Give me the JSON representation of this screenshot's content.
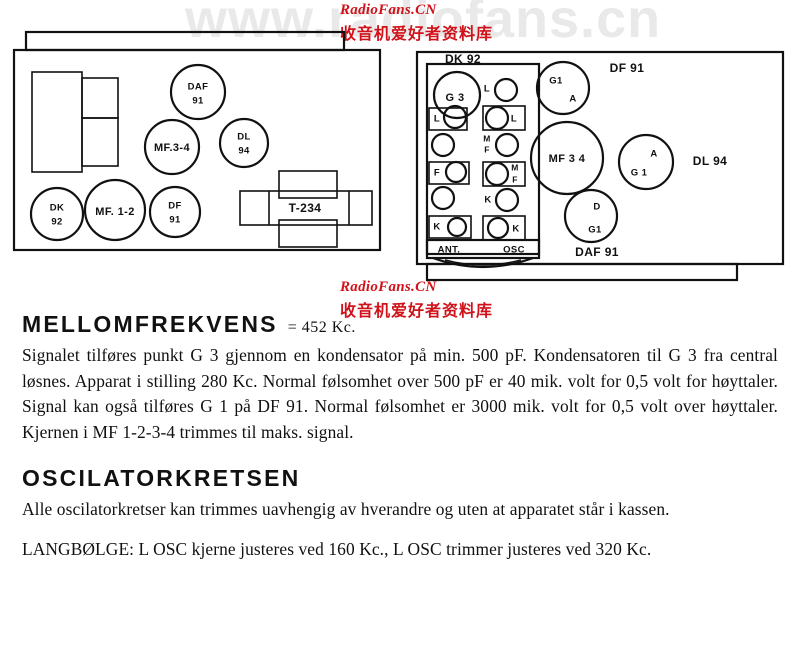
{
  "watermark": {
    "background_text": "www.radiofans.cn",
    "latin": "RadioFans.CN",
    "cjk": "收音机爱好者资料库",
    "color": "#d0121a",
    "background_color": "#e9e9e9"
  },
  "diagrams": {
    "left": {
      "caption": "chassis-top-layout",
      "components": [
        {
          "id": "DAF91",
          "line1": "DAF",
          "line2": "91",
          "shape": "circle"
        },
        {
          "id": "MF34",
          "line1": "MF.3-4",
          "line2": "",
          "shape": "circle"
        },
        {
          "id": "DL94",
          "line1": "DL",
          "line2": "94",
          "shape": "circle"
        },
        {
          "id": "DK92",
          "line1": "DK",
          "line2": "92",
          "shape": "circle"
        },
        {
          "id": "MF12",
          "line1": "MF. 1-2",
          "line2": "",
          "shape": "circle"
        },
        {
          "id": "DF91",
          "line1": "DF",
          "line2": "91",
          "shape": "circle"
        },
        {
          "id": "T234",
          "line1": "T-234",
          "line2": "",
          "shape": "rect"
        }
      ]
    },
    "right": {
      "caption": "chassis-underside-layout",
      "tube_labels": [
        {
          "id": "DK92",
          "text": "DK 92"
        },
        {
          "id": "DF91",
          "text": "DF 91"
        },
        {
          "id": "DL94",
          "text": "DL 94"
        },
        {
          "id": "DAF91",
          "text": "DAF 91"
        }
      ],
      "socket_pins": [
        {
          "id": "G3",
          "text": "G 3"
        },
        {
          "id": "L-left",
          "text": "L"
        },
        {
          "id": "F-left",
          "text": "F"
        },
        {
          "id": "K-left",
          "text": "K"
        },
        {
          "id": "L-right",
          "text": "L"
        },
        {
          "id": "MF-upper",
          "text": "M F"
        },
        {
          "id": "MF-lower",
          "text": "M F"
        },
        {
          "id": "K-right-mid",
          "text": "K"
        },
        {
          "id": "K-right-low",
          "text": "K"
        }
      ],
      "terminal_labels": [
        {
          "id": "ANT",
          "text": "ANT."
        },
        {
          "id": "OSC",
          "text": "OSC"
        }
      ],
      "tube_pins": [
        {
          "id": "DF91-G1",
          "text": "G1"
        },
        {
          "id": "DF91-A",
          "text": "A"
        },
        {
          "id": "MF34",
          "text": "MF 3 4"
        },
        {
          "id": "DL94-A",
          "text": "A"
        },
        {
          "id": "DL94-G1",
          "text": "G 1"
        },
        {
          "id": "DAF91-D",
          "text": "D"
        },
        {
          "id": "DAF91-G1",
          "text": "G1"
        }
      ]
    }
  },
  "sections": [
    {
      "id": "mellomfrekvens",
      "heading": "MELLOMFREKVENS",
      "value": "= 452 Kc.",
      "paragraphs": [
        "Signalet tilføres punkt G 3 gjennom en kondensator på min. 500 pF. Kondensatoren til G 3 fra central løsnes. Apparat i stilling 280 Kc. Normal følsomhet over 500 pF er 40 mik. volt for 0,5 volt for høyttaler. Signal kan også tilføres G 1 på DF 91. Normal følsomhet er 3000 mik. volt for 0,5 volt over høyttaler. Kjernen i MF 1-2-3-4 trimmes til maks. signal."
      ]
    },
    {
      "id": "oscilatorkretsen",
      "heading": "OSCILATORKRETSEN",
      "value": "",
      "paragraphs": [
        "Alle oscilatorkretser kan trimmes uavhengig av hverandre og uten at apparatet står i kassen."
      ]
    }
  ],
  "langbolge": {
    "text": "LANGBØLGE:  L OSC kjerne justeres ved 160 Kc., L OSC trimmer justeres ved 320 Kc."
  }
}
